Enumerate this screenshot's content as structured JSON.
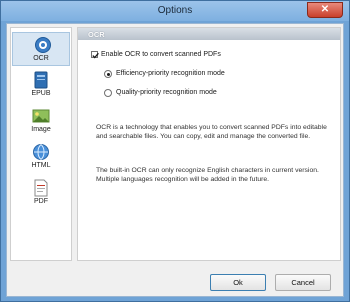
{
  "window": {
    "title": "Options",
    "close_label": "✕"
  },
  "sidebar": {
    "items": [
      {
        "label": "OCR",
        "icon": "ocr-icon",
        "selected": true
      },
      {
        "label": "EPUB",
        "icon": "epub-icon"
      },
      {
        "label": "Image",
        "icon": "image-icon"
      },
      {
        "label": "HTML",
        "icon": "html-icon"
      },
      {
        "label": "PDF",
        "icon": "pdf-icon"
      }
    ]
  },
  "panel": {
    "title": "OCR",
    "enable_ocr": {
      "label": "Enable OCR to convert scanned PDFs",
      "checked": true
    },
    "modes": [
      {
        "label": "Efficiency-priority recognition mode",
        "selected": true
      },
      {
        "label": "Quality-priority recognition mode",
        "selected": false
      }
    ],
    "description": "OCR is a technology that enables you to convert scanned PDFs into editable and searchable files. You can copy, edit and manage the converted file.",
    "note": "The built-in OCR can only recognize English characters in current version. Multiple languages recognition will be added in the future."
  },
  "footer": {
    "ok_label": "Ok",
    "cancel_label": "Cancel"
  }
}
